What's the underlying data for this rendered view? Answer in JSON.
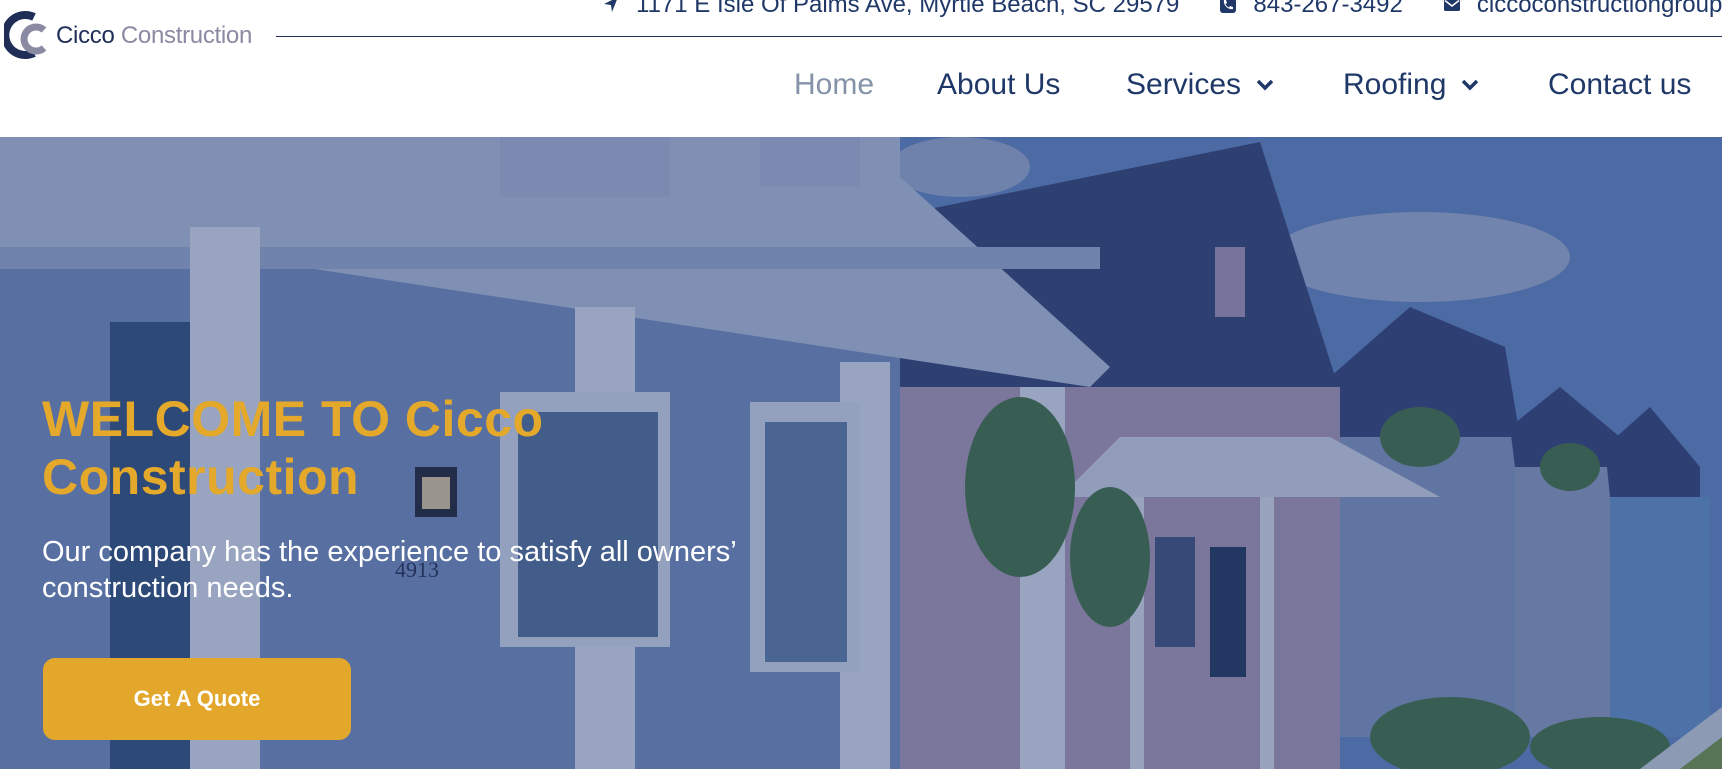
{
  "brand": {
    "name_first": "Cicco",
    "name_second": "Construction"
  },
  "topbar": {
    "address": "1171 E Isle Of Palms Ave, Myrtle Beach, SC 29579",
    "phone": "843-267-3492",
    "email": "ciccoconstructiongroup@"
  },
  "nav": {
    "items": [
      {
        "label": "Home",
        "active": true
      },
      {
        "label": "About Us"
      },
      {
        "label": "Services",
        "dropdown": true
      },
      {
        "label": "Roofing",
        "dropdown": true
      },
      {
        "label": "Contact us"
      }
    ]
  },
  "hero": {
    "title_line1": "WELCOME TO Cicco",
    "title_line2": "Construction",
    "subtitle_line1": "Our company has the experience to satisfy all owners’",
    "subtitle_line2": "construction needs.",
    "cta_label": "Get A Quote",
    "house_number": "4913"
  },
  "colors": {
    "navy": "#1f2d57",
    "nav_text": "#1f3868",
    "nav_active": "#8593a8",
    "accent": "#e3a72b"
  },
  "icons": {
    "address": "location-arrow-icon",
    "phone": "phone-icon",
    "email": "envelope-icon",
    "dropdown": "chevron-down-icon"
  }
}
